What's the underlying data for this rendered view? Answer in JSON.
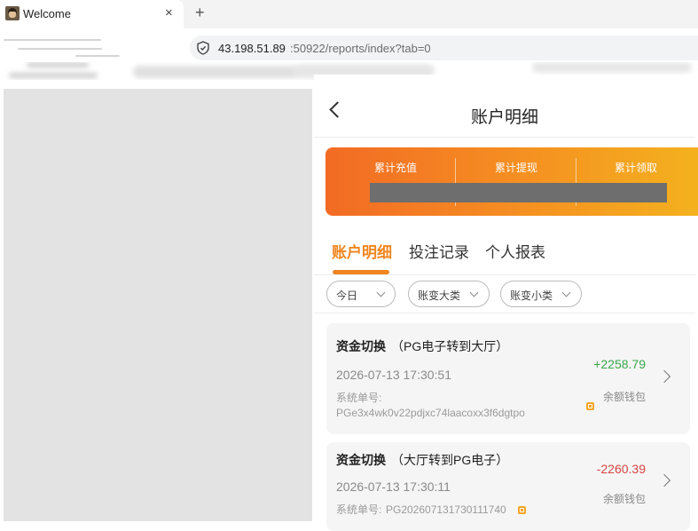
{
  "browser": {
    "tab_title": "Welcome",
    "tab_close": "×",
    "new_tab": "+",
    "url_host": "43.198.51.89",
    "url_rest": ":50922/reports/index?tab=0"
  },
  "header": {
    "title": "账户明细"
  },
  "summary": {
    "items": [
      {
        "label": "累计充值"
      },
      {
        "label": "累计提现"
      },
      {
        "label": "累计领取"
      }
    ],
    "gradient": [
      "#f26b24",
      "#f4b31e"
    ]
  },
  "tabs": [
    {
      "label": "账户明细",
      "active": true
    },
    {
      "label": "投注记录",
      "active": false
    },
    {
      "label": "个人报表",
      "active": false
    }
  ],
  "filters": [
    {
      "label": "今日"
    },
    {
      "label": "账变大类"
    },
    {
      "label": "账变小类"
    }
  ],
  "records": [
    {
      "type": "资金切换",
      "desc": "（PG电子转到大厅）",
      "time": "2026-07-13 17:30:51",
      "order_label": "系统单号:",
      "order_no": "PGe3x4wk0v22pdjxc74laacoxx3f6dgtpo",
      "amount": "+2258.79",
      "wallet": "余额钱包"
    },
    {
      "type": "资金切换",
      "desc": "（大厅转到PG电子）",
      "time": "2026-07-13 17:30:11",
      "order_label": "系统单号:",
      "order_no": "PG202607131730111740",
      "amount": "-2260.39",
      "wallet": "余额钱包"
    }
  ],
  "colors": {
    "accent": "#f0861f",
    "positive": "#3aa84a",
    "negative": "#d64541"
  }
}
